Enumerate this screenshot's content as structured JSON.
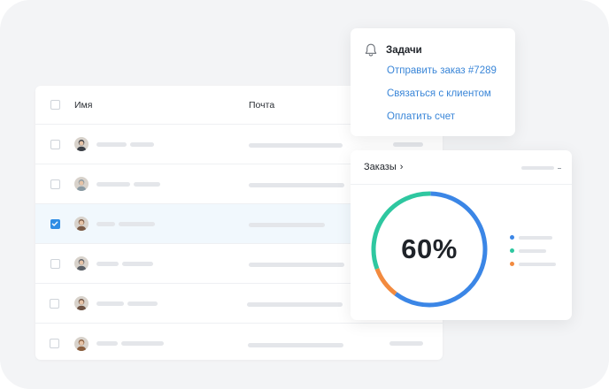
{
  "table": {
    "header": {
      "name": "Имя",
      "mail": "Почта"
    },
    "rows": [
      {
        "selected": false,
        "avatar_color": "#3b3f46",
        "name_ph": [
          34,
          27
        ],
        "mail_ph": 106,
        "extra_ph": 34
      },
      {
        "selected": false,
        "avatar_color": "#8a9aa3",
        "name_ph": [
          38,
          30
        ],
        "mail_ph": 108,
        "extra_ph": 0
      },
      {
        "selected": true,
        "avatar_color": "#7a5a45",
        "name_ph": [
          21,
          41
        ],
        "mail_ph": 86,
        "extra_ph": 0
      },
      {
        "selected": false,
        "avatar_color": "#5a5f66",
        "name_ph": [
          25,
          35
        ],
        "mail_ph": 108,
        "extra_ph": 0
      },
      {
        "selected": false,
        "avatar_color": "#6d5243",
        "name_ph": [
          31,
          34
        ],
        "mail_ph": 108,
        "extra_ph": 40
      },
      {
        "selected": false,
        "avatar_color": "#8a5f3f",
        "name_ph": [
          24,
          48
        ],
        "mail_ph": 108,
        "extra_ph": 38
      }
    ]
  },
  "tasks": {
    "title": "Задачи",
    "items": [
      {
        "label": "Отправить заказ #7289"
      },
      {
        "label": "Связаться с клиентом"
      },
      {
        "label": "Оплатить счет"
      }
    ]
  },
  "orders": {
    "title": "Заказы",
    "chevron": "›",
    "percent_label": "60%"
  },
  "chart_data": {
    "type": "pie",
    "values": [
      60,
      31,
      9
    ],
    "colors": [
      "#3b86e6",
      "#2ec7a0",
      "#f28a3f"
    ],
    "title": "",
    "legend_placement": "right"
  },
  "colors": {
    "accent": "#2f8de4",
    "link": "#3a86d8",
    "placeholder": "#e4e6ea"
  }
}
